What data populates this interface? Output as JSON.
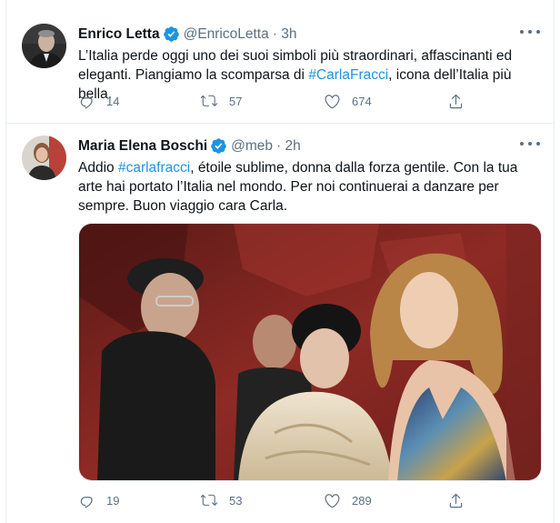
{
  "tweets": [
    {
      "author_name": "Enrico Letta",
      "handle": "@EnricoLetta",
      "time": "· 3h",
      "text_before": "L’Italia perde oggi uno dei suoi simboli più straordinari, affascinanti ed eleganti. Piangiamo la scomparsa di ",
      "hashtag": "#CarlaFracci",
      "text_after": ", icona dell’Italia più bella.",
      "replies": "14",
      "retweets": "57",
      "likes": "674"
    },
    {
      "author_name": "Maria Elena Boschi",
      "handle": "@meb",
      "time": "· 2h",
      "text_before": "Addio ",
      "hashtag": "#carlafracci",
      "text_after": ", étoile sublime, donna dalla forza gentile. Con la tua arte hai portato l’Italia nel mondo. Per noi continuerai a danzare per sempre. Buon viaggio cara Carla.",
      "replies": "19",
      "retweets": "53",
      "likes": "289"
    }
  ],
  "icons": {
    "verified": "verified-badge-icon",
    "more": "more-options-icon",
    "reply": "reply-icon",
    "retweet": "retweet-icon",
    "like": "like-icon",
    "share": "share-icon"
  },
  "colors": {
    "accent": "#1b95e0",
    "secondary_text": "#5b7083",
    "border": "#e6ecf0"
  }
}
